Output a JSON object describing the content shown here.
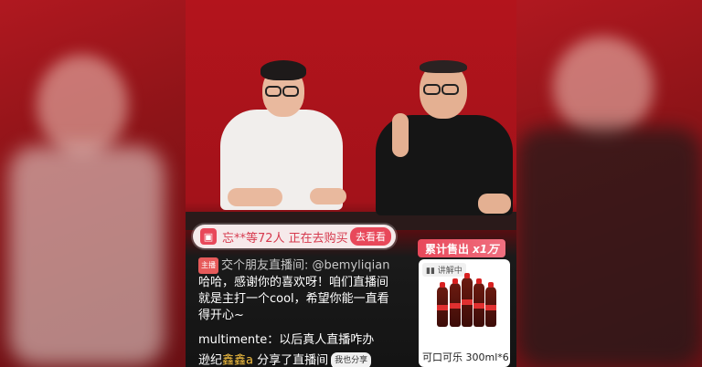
{
  "viewer_banner": {
    "text": "忘**等72人 正在去购买",
    "button": "去看看",
    "icon": "shopping-bag-icon"
  },
  "sales_badge": {
    "label": "累计售出",
    "count": "x1万"
  },
  "product_card": {
    "tag": "讲解中",
    "title": "可口可乐 300ml*6"
  },
  "comments": [
    {
      "user": "交个朋友直播间",
      "handle": "@bemyliqian"
    },
    {
      "text": "哈哈，感谢你的喜欢呀！咱们直播间"
    },
    {
      "text": "就是主打一个cool，希望你能一直看"
    },
    {
      "text": "得开心~"
    },
    {
      "user": "multimente",
      "text": "以后真人直播咋办"
    },
    {
      "user": "逊纪",
      "highlight": "鑫鑫a",
      "text": "分享了直播间",
      "button": "我也分享"
    }
  ],
  "colors": {
    "accent": "#e8485a",
    "background_red": "#b3141c"
  }
}
